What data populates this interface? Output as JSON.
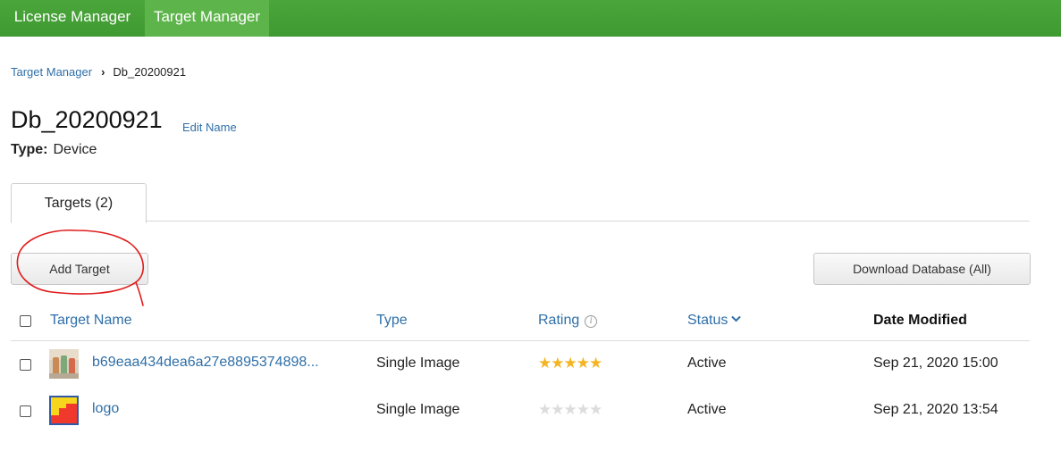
{
  "topnav": {
    "items": [
      {
        "label": "License Manager"
      },
      {
        "label": "Target Manager"
      }
    ]
  },
  "breadcrumb": {
    "parent": "Target Manager",
    "current": "Db_20200921"
  },
  "database": {
    "name": "Db_20200921",
    "edit_label": "Edit Name",
    "type_label": "Type:",
    "type_value": "Device"
  },
  "tabs": [
    {
      "label": "Targets (2)"
    }
  ],
  "toolbar": {
    "add_label": "Add Target",
    "download_label": "Download Database (All)"
  },
  "table": {
    "columns": {
      "name": "Target Name",
      "type": "Type",
      "rating": "Rating",
      "status": "Status",
      "date": "Date Modified"
    },
    "rows": [
      {
        "name": "b69eaa434dea6a27e8895374898...",
        "type": "Single Image",
        "rating": 5,
        "status": "Active",
        "date": "Sep 21, 2020 15:00"
      },
      {
        "name": "logo",
        "type": "Single Image",
        "rating": 0,
        "status": "Active",
        "date": "Sep 21, 2020 13:54"
      }
    ]
  },
  "colors": {
    "topbar": "#4aa63a",
    "active_nav": "#5db44a",
    "link": "#2f6fa8",
    "star_on": "#f3b523",
    "star_off": "#dcdcdc",
    "annotation": "#e01b1b"
  }
}
